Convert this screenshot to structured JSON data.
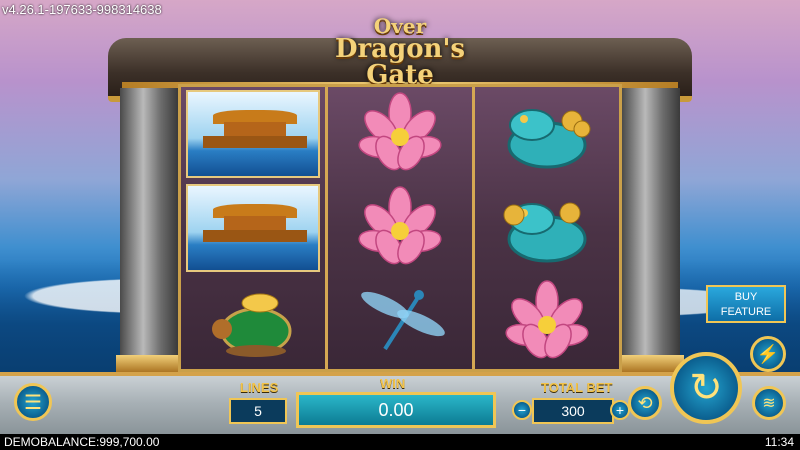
{
  "version": "v4.26.1-197633-998314638",
  "logo": {
    "line1": "Over",
    "line2": "Dragon's Gate"
  },
  "reels": [
    [
      "temple",
      "temple",
      "turtle"
    ],
    [
      "lotus",
      "lotus",
      "dragonfly"
    ],
    [
      "toad",
      "toad",
      "lotus"
    ]
  ],
  "controls": {
    "lines_label": "LINES",
    "lines_value": "5",
    "win_label": "WIN",
    "win_value": "0.00",
    "total_bet_label": "TOTAL BET",
    "total_bet_value": "300",
    "buy_feature_line1": "BUY",
    "buy_feature_line2": "FEATURE"
  },
  "status": {
    "balance": "DEMOBALANCE:999,700.00",
    "time": "11:34"
  },
  "icons": {
    "menu": "menu-icon",
    "spin": "spin-icon",
    "turbo": "lightning-icon",
    "autoplay": "autoplay-icon",
    "stake": "coins-icon",
    "minus": "minus-icon",
    "plus": "plus-icon"
  }
}
